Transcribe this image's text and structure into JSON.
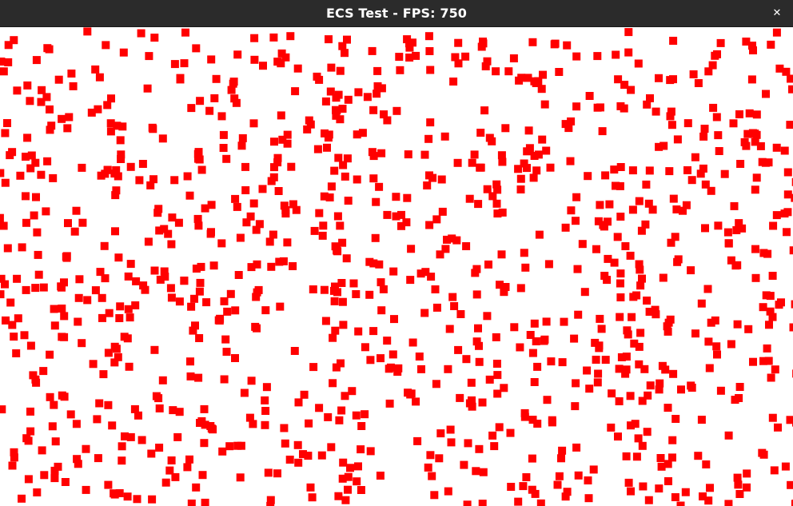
{
  "window": {
    "title": "ECS Test - FPS: 750",
    "close_glyph": "✕",
    "close_icon": "close-icon"
  },
  "scene": {
    "background_color": "#ffffff",
    "entity_color": "#ff0000",
    "entity_shape": "square"
  }
}
